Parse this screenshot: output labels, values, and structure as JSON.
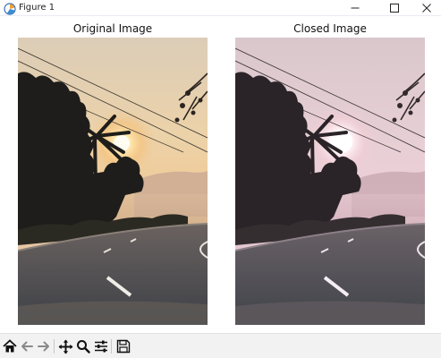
{
  "window": {
    "title": "Figure 1",
    "controls": [
      "minimize",
      "maximize",
      "close"
    ]
  },
  "subplots": [
    {
      "title": "Original Image",
      "image": "sunset-road-original",
      "tone": "warm-orange"
    },
    {
      "title": "Closed Image",
      "image": "sunset-road-closed",
      "tone": "pink-purple"
    }
  ],
  "toolbar": {
    "buttons": [
      {
        "icon": "home-icon",
        "label": "Home"
      },
      {
        "icon": "back-arrow-icon",
        "label": "Back"
      },
      {
        "icon": "forward-arrow-icon",
        "label": "Forward"
      },
      {
        "icon": "pan-icon",
        "label": "Pan"
      },
      {
        "icon": "zoom-icon",
        "label": "Zoom"
      },
      {
        "icon": "configure-subplots-icon",
        "label": "Configure subplots"
      },
      {
        "icon": "save-icon",
        "label": "Save"
      }
    ]
  },
  "colors": {
    "original_sky_top": "#e8d8bf",
    "original_sky_glow": "#f2c98c",
    "closed_sky_top": "#e4cdd2",
    "closed_sky_glow": "#f0cdd6",
    "road": "#4a4d52"
  }
}
